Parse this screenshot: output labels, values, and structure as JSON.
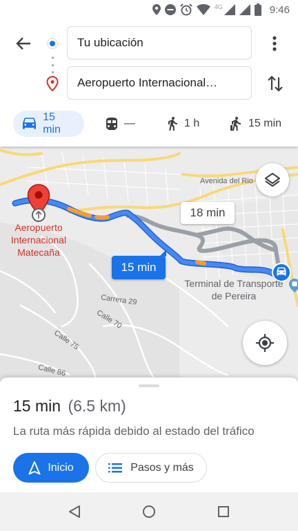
{
  "status_bar": {
    "time": "9:46",
    "network": "4G"
  },
  "header": {
    "back_icon": "arrow-back-icon",
    "origin_value": "Tu ubicación",
    "destination_value": "Aeropuerto Internacional…",
    "more_icon": "more-vert-icon",
    "swap_icon": "swap-vert-icon"
  },
  "modes": [
    {
      "icon": "car-icon",
      "label": "15 min",
      "active": true
    },
    {
      "icon": "train-icon",
      "label": "—",
      "active": false
    },
    {
      "icon": "walk-icon",
      "label": "1 h",
      "active": false
    },
    {
      "icon": "ride-icon",
      "label": "15 min",
      "active": false
    }
  ],
  "map": {
    "labels": {
      "avenida": "Avenida del Rio",
      "carrera29": "Carrera 29",
      "calle70": "Calle 70",
      "calle75": "Calle 75",
      "calle86": "Calle 86"
    },
    "airport_label": "Aeropuerto Internacional Matecaña",
    "terminal_label": "Terminal de Transporte de Pereira",
    "primary_route_time": "15 min",
    "alt_route_time": "18 min",
    "colors": {
      "route": "#4a87f5",
      "route_alt": "#9aa0a6",
      "traffic": "#f29c38",
      "pin": "#ea4335"
    }
  },
  "sheet": {
    "duration": "15 min",
    "distance": "(6.5 km)",
    "summary": "La ruta más rápida debido al estado del tráfico",
    "start_label": "Inicio",
    "steps_label": "Pasos y más"
  }
}
